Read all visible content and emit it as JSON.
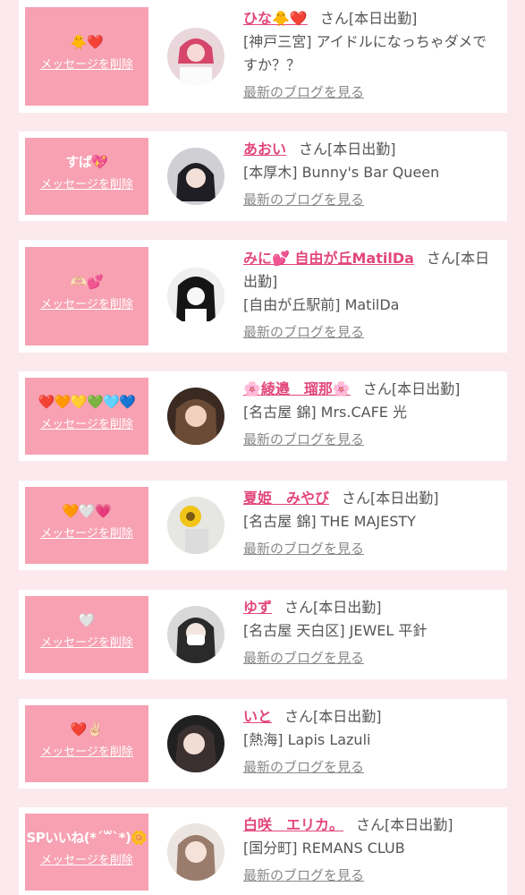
{
  "delete_label": "メッセージを削除",
  "blog_label": "最新のブログを見る",
  "san_label": "さん",
  "colors": {
    "pink_box": "#f7a1b2",
    "name_link": "#e2477a",
    "background": "#fbe9ee"
  },
  "items": [
    {
      "message": "🐥❤️",
      "name": "ひな🐥❤️",
      "status": "[本日出勤]",
      "shop": "[神戸三宮] アイドルになっちゃダメですか？？",
      "avatar_icon": "avatar-photo"
    },
    {
      "message": "すば💖",
      "name": "あおい",
      "status": "[本日出勤]",
      "shop": "[本厚木] Bunny's Bar Queen",
      "avatar_icon": "avatar-photo"
    },
    {
      "message": "🫶🏻💕",
      "name": "みに💕 自由が丘MatilDa",
      "status": "[本日出勤]",
      "shop": "[自由が丘駅前] MatilDa",
      "avatar_icon": "avatar-photo"
    },
    {
      "message": "❤️🧡💛💚🩵💙",
      "name": "🌸綾邉　瑠那🌸",
      "status": "[本日出勤]",
      "shop": "[名古屋 錦] Mrs.CAFE 光",
      "avatar_icon": "avatar-photo"
    },
    {
      "message": "🧡🤍💗",
      "name": "夏姫　みやび",
      "status": "[本日出勤]",
      "shop": "[名古屋 錦] THE MAJESTY",
      "avatar_icon": "avatar-photo"
    },
    {
      "message": "🤍",
      "name": "ゆず",
      "status": "[本日出勤]",
      "shop": "[名古屋 天白区] JEWEL 平針",
      "avatar_icon": "avatar-photo"
    },
    {
      "message": "❤️✌🏻",
      "name": "いと",
      "status": "[本日出勤]",
      "shop": "[熱海] Lapis Lazuli",
      "avatar_icon": "avatar-photo"
    },
    {
      "message": "SPいいね(*´꒳`*)🌼",
      "name": "白咲　エリカ。",
      "status": "[本日出勤]",
      "shop": "[国分町] REMANS CLUB",
      "avatar_icon": "avatar-photo"
    }
  ]
}
